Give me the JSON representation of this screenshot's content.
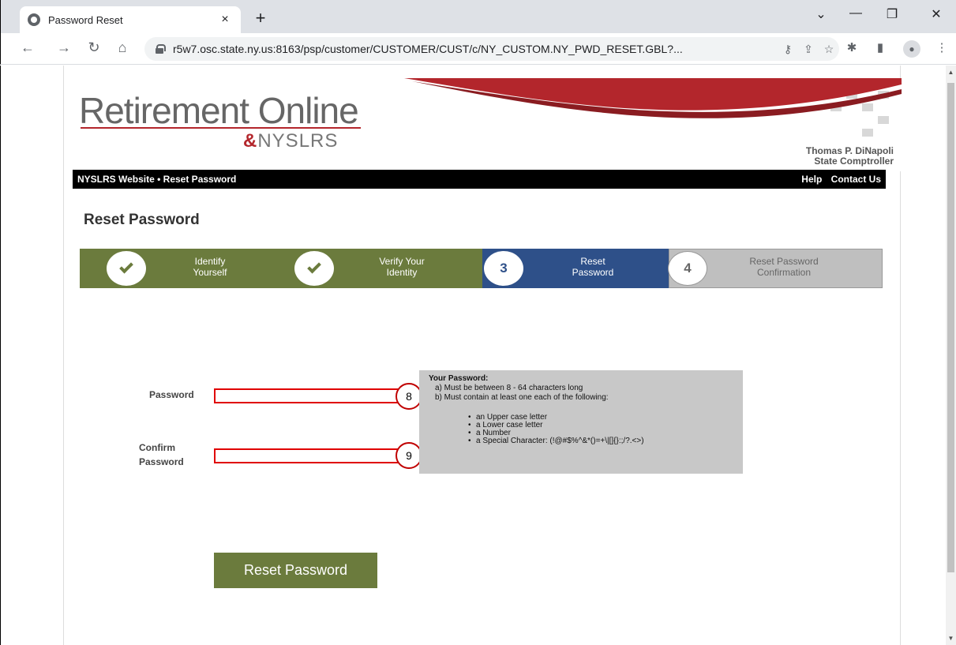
{
  "browser": {
    "tab_title": "Password Reset",
    "tab_close": "×",
    "new_tab": "+",
    "url": "r5w7.osc.state.ny.us:8163/psp/customer/CUSTOMER/CUST/c/NY_CUSTOM.NY_PWD_RESET.GBL?...",
    "icons": [
      "back-icon",
      "forward-icon",
      "reload-icon",
      "home-icon",
      "lock-icon",
      "key-icon",
      "share-icon",
      "star-icon",
      "extensions-icon",
      "sidepanel-icon",
      "profile-icon",
      "menu-icon"
    ]
  },
  "header": {
    "logo_main": "Retirement Online",
    "logo_amp": "&",
    "logo_sub": "NYSLRS",
    "comptroller_name": "Thomas P. DiNapoli",
    "comptroller_title": "State Comptroller"
  },
  "navbar": {
    "breadcrumb": "NYSLRS Website • Reset Password",
    "help": "Help",
    "contact": "Contact Us"
  },
  "page_title": "Reset Password",
  "steps": [
    {
      "number": "✓",
      "label_1": "Identify",
      "label_2": "Yourself",
      "state": "done"
    },
    {
      "number": "✓",
      "label_1": "Verify Your",
      "label_2": "Identity",
      "state": "done"
    },
    {
      "number": "3",
      "label_1": "Reset",
      "label_2": "Password",
      "state": "active"
    },
    {
      "number": "4",
      "label_1": "Reset Password",
      "label_2": "Confirmation",
      "state": "todo"
    }
  ],
  "form": {
    "password_label": "Password",
    "confirm_label_1": "Confirm",
    "confirm_label_2": "Password",
    "password_value": "",
    "confirm_value": "",
    "callout_1": "8",
    "callout_2": "9"
  },
  "rules": {
    "heading": "Your Password:",
    "rule_a": "a) Must be between 8 - 64 characters long",
    "rule_b": "b) Must contain at least one each of the following:",
    "items": [
      "an Upper case letter",
      "a Lower case letter",
      "a Number",
      "a Special Character: (!@#$%^&*()=+\\|[]{}:;/?.<>)"
    ]
  },
  "reset_button": "Reset Password",
  "colors": {
    "green": "#6b7b3d",
    "blue": "#2e5089",
    "gray": "#bfbfbf",
    "red": "#b3262c"
  }
}
